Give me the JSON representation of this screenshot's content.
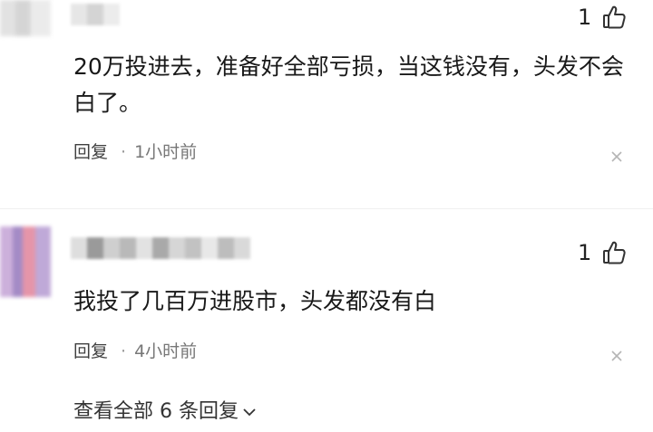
{
  "comments": [
    {
      "text": "20万投进去，准备好全部亏损，当这钱没有，头发不会白了。",
      "likes": "1",
      "reply_label": "回复",
      "separator": "·",
      "time": "1小时前"
    },
    {
      "text": "我投了几百万进股市，头发都没有白",
      "likes": "1",
      "reply_label": "回复",
      "separator": "·",
      "time": "4小时前"
    }
  ],
  "view_all_replies": "查看全部 6 条回复",
  "icons": {
    "like": "thumbs-up-icon",
    "close": "close-icon",
    "expand": "chevron-down-icon"
  },
  "colors": {
    "text": "#191919",
    "meta": "#777777",
    "icon": "#333333"
  }
}
